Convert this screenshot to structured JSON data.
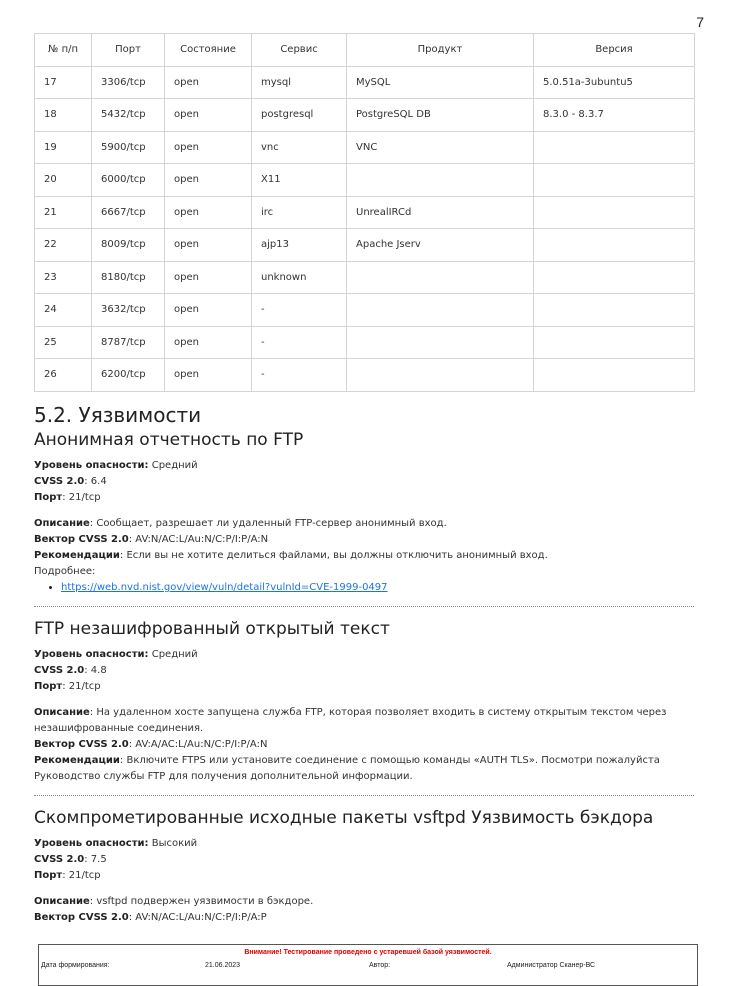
{
  "page_number": "7",
  "ports_table": {
    "headers": [
      "№ п/п",
      "Порт",
      "Состояние",
      "Сервис",
      "Продукт",
      "Версия"
    ],
    "rows": [
      [
        "17",
        "3306/tcp",
        "open",
        "mysql",
        "MySQL",
        "5.0.51a-3ubuntu5"
      ],
      [
        "18",
        "5432/tcp",
        "open",
        "postgresql",
        "PostgreSQL DB",
        "8.3.0 - 8.3.7"
      ],
      [
        "19",
        "5900/tcp",
        "open",
        "vnc",
        "VNC",
        ""
      ],
      [
        "20",
        "6000/tcp",
        "open",
        "X11",
        "",
        ""
      ],
      [
        "21",
        "6667/tcp",
        "open",
        "irc",
        "UnrealIRCd",
        ""
      ],
      [
        "22",
        "8009/tcp",
        "open",
        "ajp13",
        "Apache Jserv",
        ""
      ],
      [
        "23",
        "8180/tcp",
        "open",
        "unknown",
        "",
        ""
      ],
      [
        "24",
        "3632/tcp",
        "open",
        "-",
        "",
        ""
      ],
      [
        "25",
        "8787/tcp",
        "open",
        "-",
        "",
        ""
      ],
      [
        "26",
        "6200/tcp",
        "open",
        "-",
        "",
        ""
      ]
    ]
  },
  "section_title": "5.2. Уязвимости",
  "labels": {
    "severity": "Уровень опасности:",
    "cvss": "CVSS 2.0",
    "port": "Порт",
    "description": "Описание",
    "vector": "Вектор CVSS 2.0",
    "recommendations": "Рекомендации",
    "more": "Подробнее:"
  },
  "vulnerabilities": [
    {
      "title": "Анонимная отчетность по FTP",
      "severity": "Средний",
      "cvss": "6.4",
      "port": "21/tcp",
      "description": "Сообщает, разрешает ли удаленный FTP-сервер анонимный вход.",
      "vector": "AV:N/AC:L/Au:N/C:P/I:P/A:N",
      "recommendations": "Если вы не хотите делиться файлами, вы должны отключить анонимный вход.",
      "link": "https://web.nvd.nist.gov/view/vuln/detail?vulnId=CVE-1999-0497"
    },
    {
      "title": "FTP незашифрованный открытый текст",
      "severity": "Средний",
      "cvss": "4.8",
      "port": "21/tcp",
      "description": "На удаленном хосте запущена служба FTP, которая позволяет входить в систему открытым текстом через незашифрованные соединения.",
      "vector": "AV:A/AC:L/Au:N/C:P/I:P/A:N",
      "recommendations": "Включите FTPS или установите соединение с помощью команды «AUTH TLS». Посмотри пожалуйста Руководство службы FTP для получения дополнительной информации."
    },
    {
      "title": "Скомпрометированные исходные пакеты vsftpd Уязвимость бэкдора",
      "severity": "Высокий",
      "cvss": "7.5",
      "port": "21/tcp",
      "description": "vsftpd подвержен уязвимости в бэкдоре.",
      "vector": "AV:N/AC:L/Au:N/C:P/I:P/A:P"
    }
  ],
  "footer": {
    "warning": "Внимание! Тестирование проведено с устаревшей базой уязвимостей.",
    "date_label": "Дата формирования:",
    "date_value": "21.06.2023",
    "author_label": "Автор:",
    "author_value": "Администратор Сканер-ВС"
  }
}
